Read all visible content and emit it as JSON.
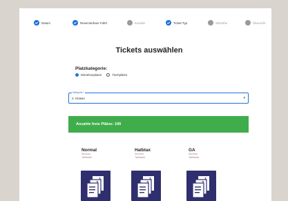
{
  "stepper": {
    "steps": [
      {
        "label": "Datum",
        "state": "done"
      },
      {
        "label": "Reservierbare Fahrt",
        "state": "done"
      },
      {
        "label": "Kontakt",
        "state": "todo"
      },
      {
        "label": "Ticket-Typ",
        "state": "current"
      },
      {
        "label": "Sitzreihe",
        "state": "todo"
      },
      {
        "label": "Übersicht",
        "state": "todo"
      }
    ]
  },
  "title": "Tickets auswählen",
  "category": {
    "label": "Platzkategorie:",
    "options": [
      "Mirrahmeplatze",
      "Tischplätze"
    ],
    "selected": "Mirrahmeplatze"
  },
  "class_select": {
    "float_label": "Kategorie *",
    "value": "2. Klasse"
  },
  "availability_banner": "Anzahle freie Plätze: 100",
  "tickets": [
    {
      "name": "Normal",
      "sub1": "Seniors",
      "sub2": "Tarifstufe"
    },
    {
      "name": "Halbtax",
      "sub1": "Seniors",
      "sub2": "Tarifstufe"
    },
    {
      "name": "GA",
      "sub1": "Seniors",
      "sub2": "Tarifstufe"
    }
  ],
  "colors": {
    "primary": "#1e6fd9",
    "success": "#3fad4b",
    "card": "#2f2e6e"
  }
}
